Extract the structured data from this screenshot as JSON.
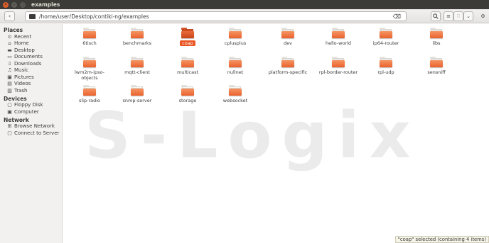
{
  "window": {
    "title": "examples"
  },
  "toolbar": {
    "back_icon": "chevron-left",
    "forward_icon": "chevron-right",
    "path": "/home/user/Desktop/contiki-ng/examples",
    "search_icon": "search",
    "list_icon": "list",
    "grid_icon": "grid",
    "dropdown_icon": "chevron-down",
    "settings_icon": "gear"
  },
  "sidebar": {
    "places_header": "Places",
    "places": [
      {
        "label": "Recent",
        "icon": "⊙"
      },
      {
        "label": "Home",
        "icon": "⌂"
      },
      {
        "label": "Desktop",
        "icon": "▬"
      },
      {
        "label": "Documents",
        "icon": "▭"
      },
      {
        "label": "Downloads",
        "icon": "⇩"
      },
      {
        "label": "Music",
        "icon": "♫"
      },
      {
        "label": "Pictures",
        "icon": "▣"
      },
      {
        "label": "Videos",
        "icon": "▤"
      },
      {
        "label": "Trash",
        "icon": "▥"
      }
    ],
    "devices_header": "Devices",
    "devices": [
      {
        "label": "Floppy Disk",
        "icon": "▢"
      },
      {
        "label": "Computer",
        "icon": "▣"
      }
    ],
    "network_header": "Network",
    "network": [
      {
        "label": "Browse Network",
        "icon": "⊞"
      },
      {
        "label": "Connect to Server",
        "icon": "▢"
      }
    ]
  },
  "folders": [
    {
      "name": "6tisch"
    },
    {
      "name": "benchmarks"
    },
    {
      "name": "coap",
      "selected": true
    },
    {
      "name": "cplusplus"
    },
    {
      "name": "dev"
    },
    {
      "name": "hello-world"
    },
    {
      "name": "ip64-router"
    },
    {
      "name": "libs"
    },
    {
      "name": "lwm2m-ipso-objects"
    },
    {
      "name": "mqtt-client"
    },
    {
      "name": "multicast"
    },
    {
      "name": "nullnet"
    },
    {
      "name": "platform-specific"
    },
    {
      "name": "rpl-border-router"
    },
    {
      "name": "rpl-udp"
    },
    {
      "name": "sensniff"
    },
    {
      "name": "slip-radio"
    },
    {
      "name": "snmp-server"
    },
    {
      "name": "storage"
    },
    {
      "name": "websocket"
    }
  ],
  "watermark": "S-Logix",
  "status": "\"coap\" selected (containing 4 items)",
  "colors": {
    "accent": "#e95420",
    "folder": "#f07a45"
  }
}
